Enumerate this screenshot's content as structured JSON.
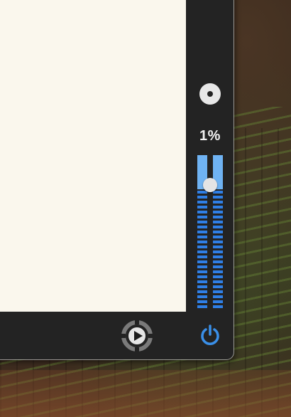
{
  "volume": {
    "label": "1%",
    "level_fraction": 0.01
  },
  "controls": {
    "disc_icon": "disc-icon",
    "play_icon": "play-circle-icon",
    "power_icon": "power-icon"
  },
  "colors": {
    "meter_blue": "#2f7fe6",
    "meter_light_blue": "#6fb3f3",
    "power_blue": "#3a8fe8",
    "panel_dark": "#232323",
    "paper": "#faf7ed"
  }
}
